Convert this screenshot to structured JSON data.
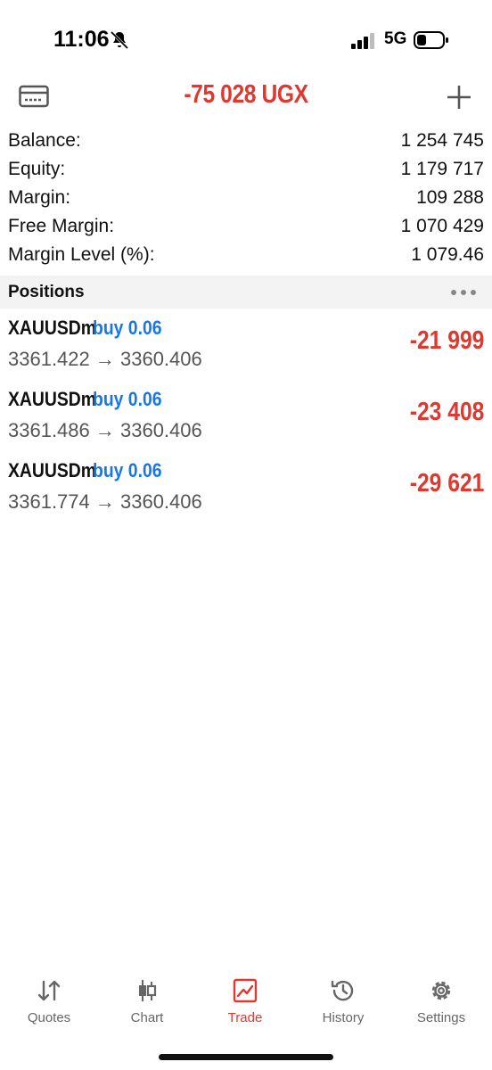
{
  "status_bar": {
    "time": "11:06",
    "network": "5G"
  },
  "header": {
    "title": "-75 028 UGX",
    "icons": [
      "card-icon",
      "plus-icon"
    ]
  },
  "summary": {
    "rows": [
      {
        "label": "Balance:",
        "value": "1 254 745"
      },
      {
        "label": "Equity:",
        "value": "1 179 717"
      },
      {
        "label": "Margin:",
        "value": "109 288"
      },
      {
        "label": "Free Margin:",
        "value": "1 070 429"
      },
      {
        "label": "Margin Level (%):",
        "value": "1 079.46"
      }
    ]
  },
  "positions": {
    "title": "Positions",
    "items": [
      {
        "symbol": "XAUUSDm",
        "side": "buy 0.06",
        "prices": "3361.422 → 3360.406",
        "profit": "-21 999"
      },
      {
        "symbol": "XAUUSDm",
        "side": "buy 0.06",
        "prices": "3361.486 → 3360.406",
        "profit": "-23 408"
      },
      {
        "symbol": "XAUUSDm",
        "side": "buy 0.06",
        "prices": "3361.774 → 3360.406",
        "profit": "-29 621"
      }
    ]
  },
  "tabbar": {
    "tabs": [
      {
        "label": "Quotes",
        "icon": "quotes-icon"
      },
      {
        "label": "Chart",
        "icon": "chart-icon"
      },
      {
        "label": "Trade",
        "icon": "trade-icon",
        "active": true
      },
      {
        "label": "History",
        "icon": "history-icon"
      },
      {
        "label": "Settings",
        "icon": "settings-icon"
      }
    ]
  },
  "colors": {
    "loss": "#e0382e",
    "side": "#1877e6",
    "active_tab": "#e0382e"
  }
}
